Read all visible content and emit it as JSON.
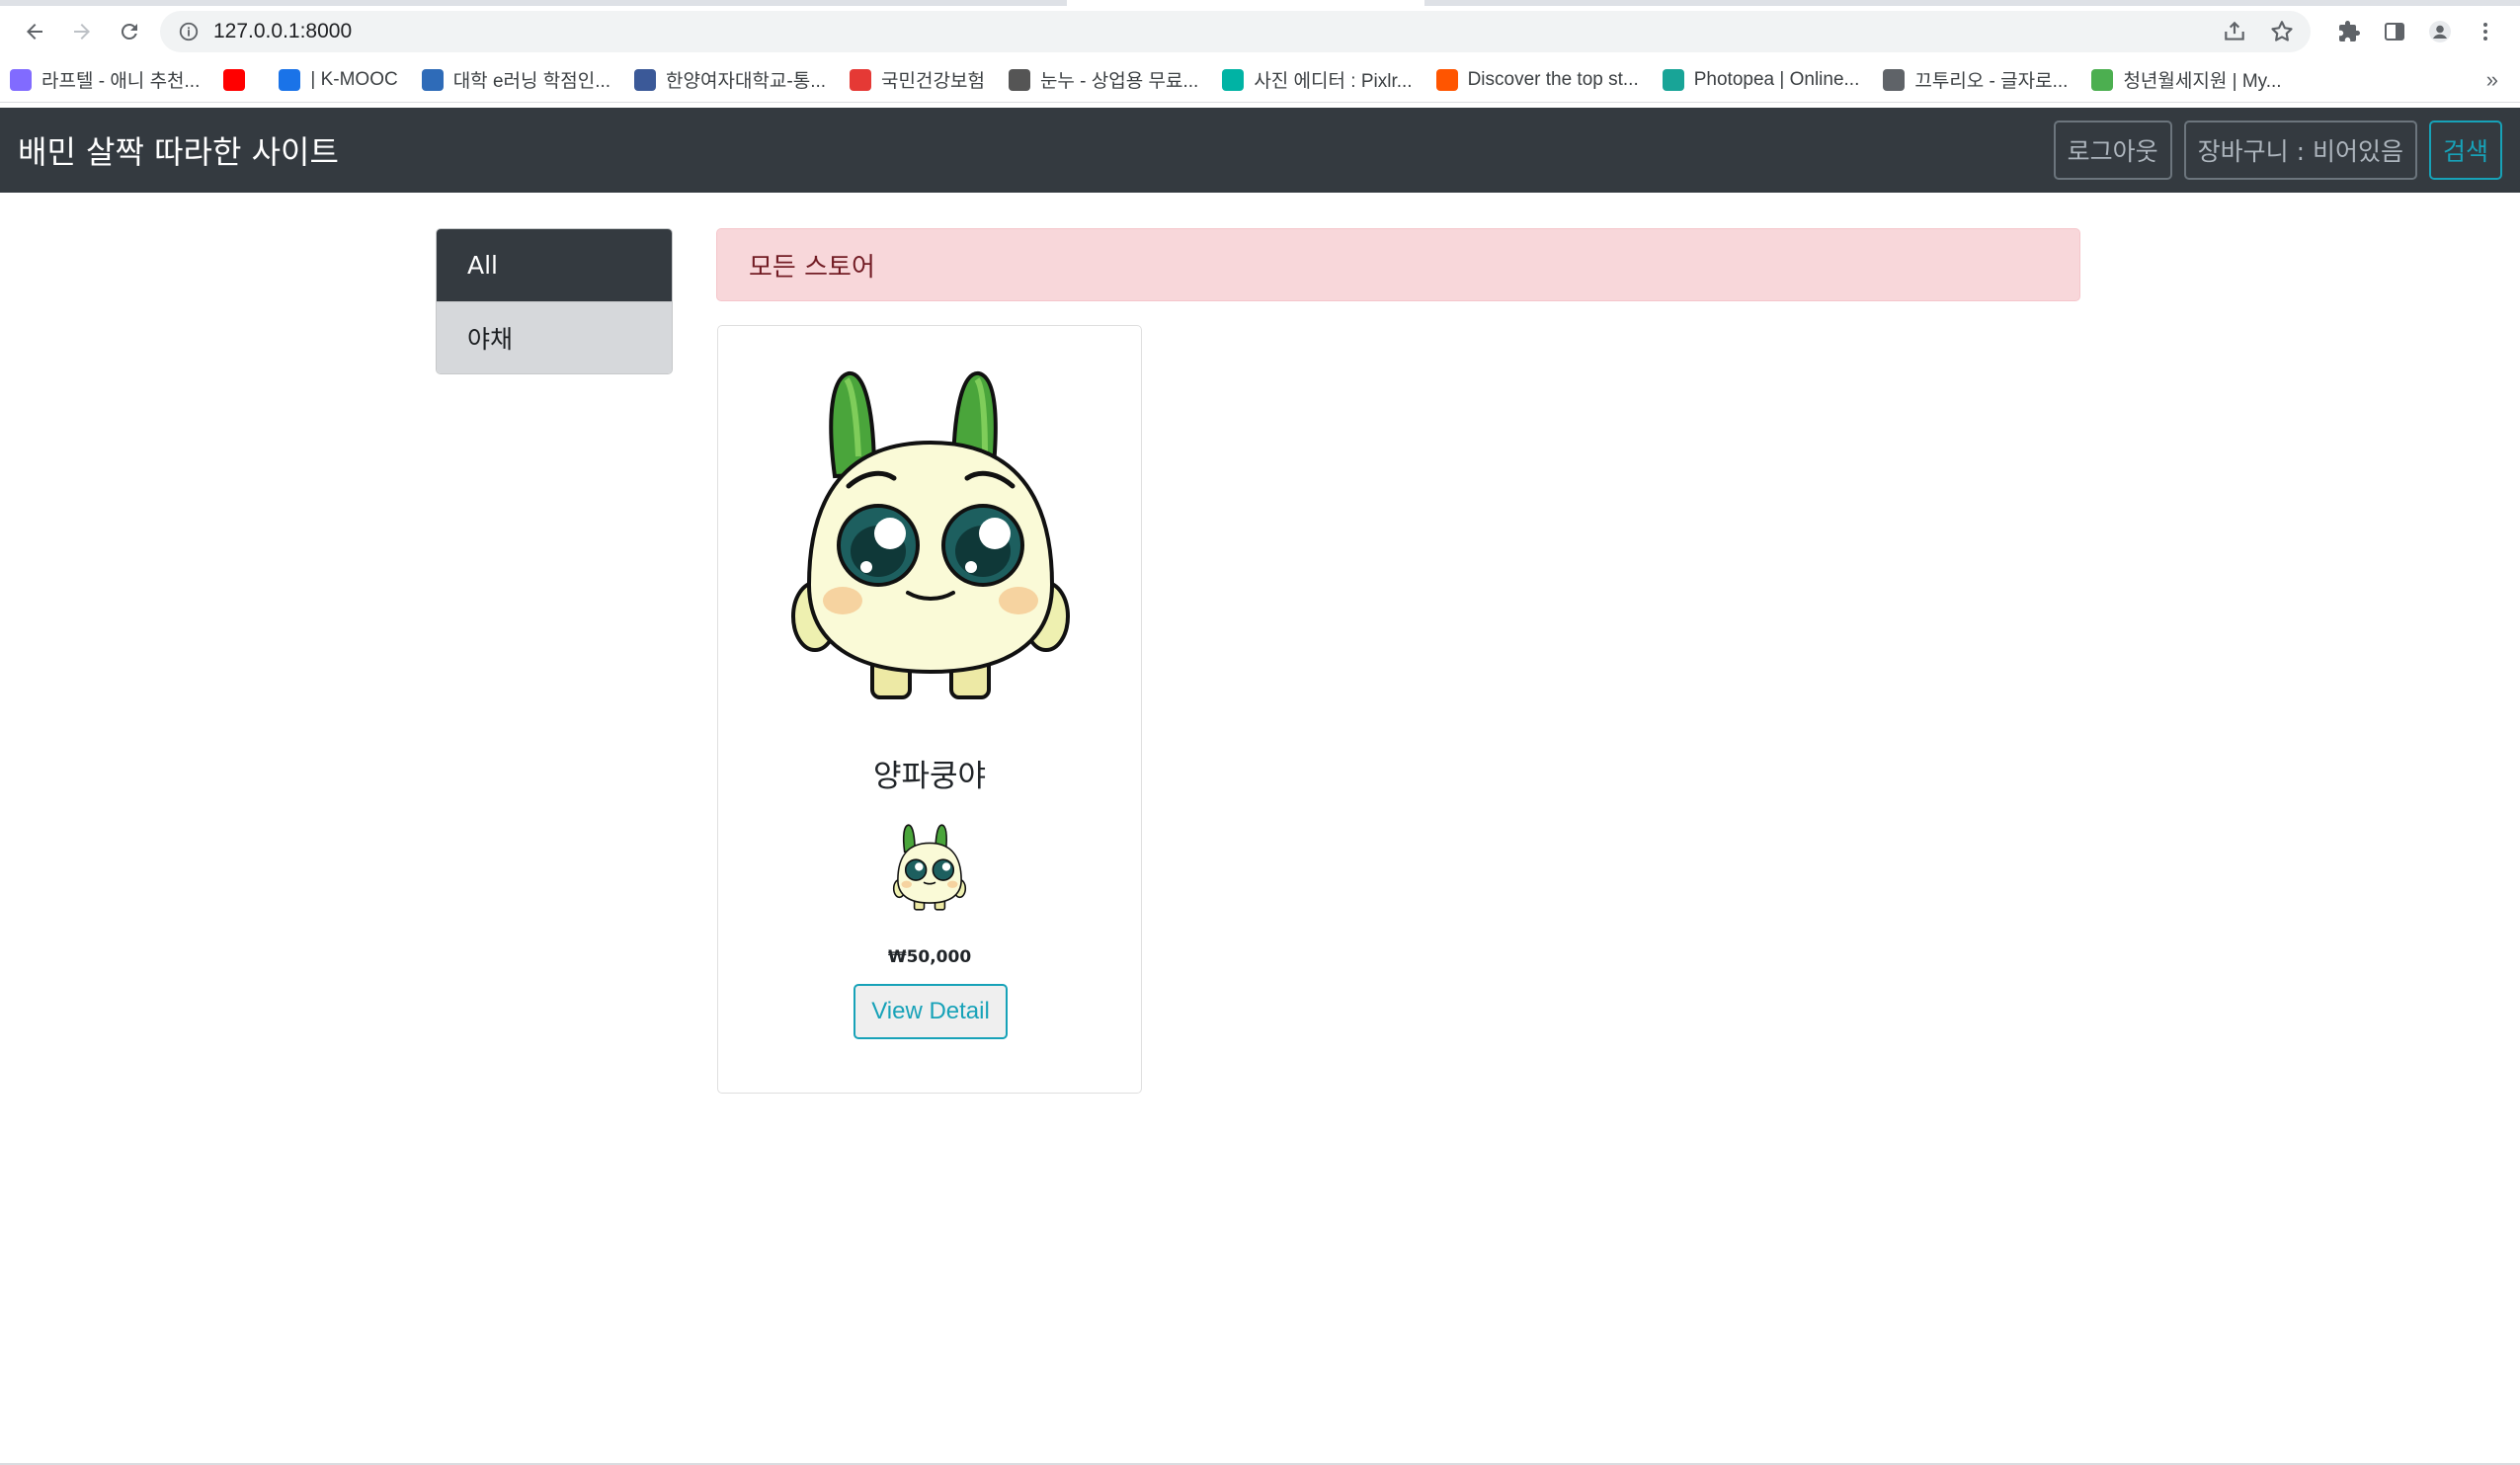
{
  "browser": {
    "url": "127.0.0.1:8000",
    "bookmarks": [
      {
        "label": "라프텔 - 애니 추천...",
        "icon": "laftel-icon",
        "color": "#816bff"
      },
      {
        "label": "",
        "icon": "youtube-icon",
        "color": "#ff0000"
      },
      {
        "label": "| K-MOOC",
        "icon": "kmooc-icon",
        "color": "#1a73e8"
      },
      {
        "label": "대학 e러닝 학점인...",
        "icon": "infinity-icon",
        "color": "#2e6bb8"
      },
      {
        "label": "한양여자대학교-통...",
        "icon": "university-icon",
        "color": "#3b5998"
      },
      {
        "label": "국민건강보험",
        "icon": "health-insurance-icon",
        "color": "#e53935"
      },
      {
        "label": "눈누 - 상업용 무료...",
        "icon": "noonnu-icon",
        "color": "#555555"
      },
      {
        "label": "사진 에디터 : Pixlr...",
        "icon": "pixlr-icon",
        "color": "#00b3a4"
      },
      {
        "label": "Discover the top st...",
        "icon": "soundcloud-icon",
        "color": "#ff5500"
      },
      {
        "label": "Photopea | Online...",
        "icon": "photopea-icon",
        "color": "#18a497"
      },
      {
        "label": "끄투리오 - 글자로...",
        "icon": "globe-icon",
        "color": "#5f6368"
      },
      {
        "label": "청년월세지원 | My...",
        "icon": "pinwheel-icon",
        "color": "#4caf50"
      }
    ],
    "more_label": "»"
  },
  "navbar": {
    "brand": "배민 살짝 따라한 사이트",
    "logout": "로그아웃",
    "cart": "장바구니 : 비어있음",
    "search": "검색"
  },
  "sidebar": {
    "items": [
      {
        "label": "All",
        "active": true
      },
      {
        "label": "야채",
        "active": false
      }
    ]
  },
  "alert": {
    "text": "모든 스토어"
  },
  "products": [
    {
      "name": "양파쿵야",
      "price": "₩50,000",
      "button": "View Detail"
    }
  ],
  "colors": {
    "navbar_bg": "#343a40",
    "info": "#17a2b8",
    "alert_bg": "#f8d7da",
    "alert_text": "#721c24"
  }
}
